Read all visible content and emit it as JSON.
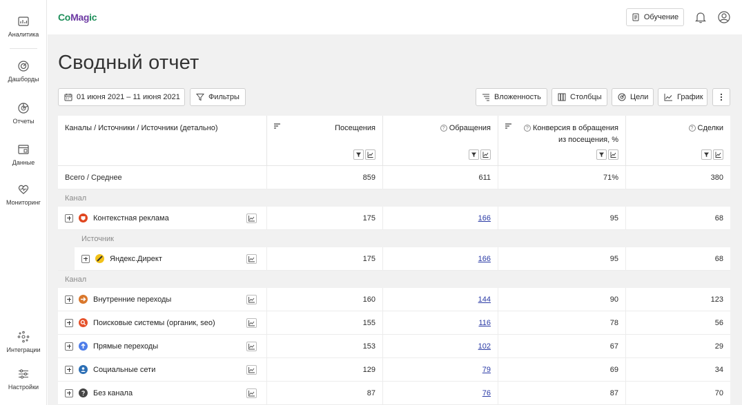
{
  "sidebar": {
    "items": [
      {
        "label": "Аналитика",
        "icon": "analytics-icon"
      },
      {
        "label": "Дашборды",
        "icon": "dashboards-icon"
      },
      {
        "label": "Отчеты",
        "icon": "reports-icon"
      },
      {
        "label": "Данные",
        "icon": "data-icon"
      },
      {
        "label": "Мониторинг",
        "icon": "monitoring-icon"
      }
    ],
    "bottom_items": [
      {
        "label": "Интеграции",
        "icon": "integrations-icon"
      },
      {
        "label": "Настройки",
        "icon": "settings-icon"
      }
    ]
  },
  "header": {
    "logo_part1": "Co",
    "logo_part2": "Mag",
    "logo_part3": "ic",
    "learn_label": "Обучение"
  },
  "page": {
    "title": "Сводный отчет"
  },
  "toolbar": {
    "date_range": "01 июня 2021 – 11 июня 2021",
    "filters_label": "Фильтры",
    "nesting_label": "Вложенность",
    "columns_label": "Столбцы",
    "goals_label": "Цели",
    "chart_label": "График"
  },
  "table": {
    "columns": [
      "Каналы / Источники / Источники (детально)",
      "Посещения",
      "Обращения",
      "Конверсия в обращения",
      "из посещения, %",
      "Сделки"
    ],
    "total": {
      "label": "Всего / Среднее",
      "visits": "859",
      "requests": "611",
      "conversion": "71%",
      "deals": "380"
    },
    "group_channel": "Канал",
    "group_source": "Источник",
    "rows": [
      {
        "name": "Контекстная реклама",
        "visits": "175",
        "requests": "166",
        "conversion": "95",
        "deals": "68",
        "color": "#e0461f"
      },
      {
        "name": "Яндекс.Директ",
        "visits": "175",
        "requests": "166",
        "conversion": "95",
        "deals": "68",
        "color": "#f2c21a"
      },
      {
        "name": "Внутренние переходы",
        "visits": "160",
        "requests": "144",
        "conversion": "90",
        "deals": "123",
        "color": "#d9772c"
      },
      {
        "name": "Поисковые системы (органик, seo)",
        "visits": "155",
        "requests": "116",
        "conversion": "78",
        "deals": "56",
        "color": "#e5512a"
      },
      {
        "name": "Прямые переходы",
        "visits": "153",
        "requests": "102",
        "conversion": "67",
        "deals": "29",
        "color": "#4e7de9"
      },
      {
        "name": "Социальные сети",
        "visits": "129",
        "requests": "79",
        "conversion": "69",
        "deals": "34",
        "color": "#2c6fb5"
      },
      {
        "name": "Без канала",
        "visits": "87",
        "requests": "76",
        "conversion": "87",
        "deals": "70",
        "color": "#444444"
      }
    ]
  }
}
